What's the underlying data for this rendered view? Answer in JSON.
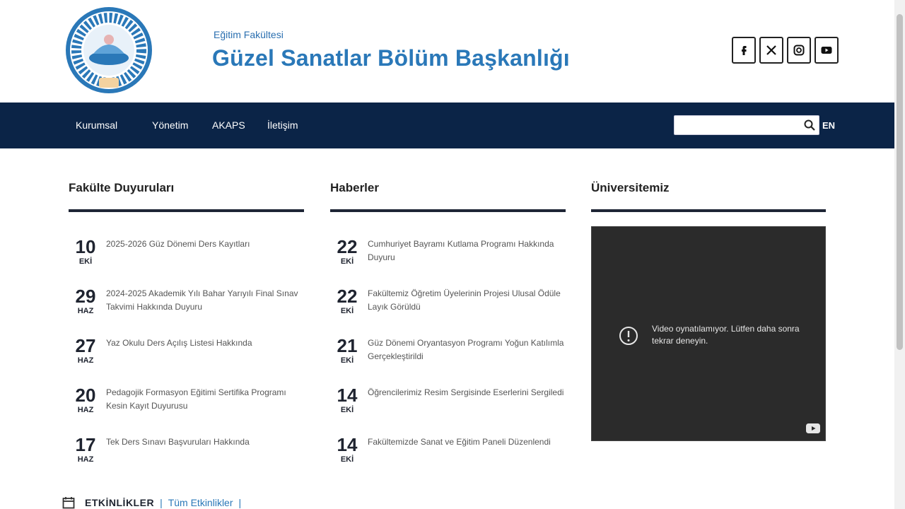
{
  "header": {
    "faculty_name": "Eğitim Fakültesi",
    "site_title": "Güzel Sanatlar Bölüm Başkanlığı",
    "social": [
      "facebook-icon",
      "x-icon",
      "instagram-icon",
      "youtube-icon"
    ]
  },
  "nav": {
    "items": [
      "Kurumsal",
      "Yönetim",
      "AKAPS",
      "İletişim"
    ],
    "search_placeholder": "",
    "lang": "EN"
  },
  "columns": {
    "events": {
      "title": "Fakülte Duyuruları",
      "items": [
        {
          "day": "10",
          "month": "EKİ",
          "text": "2025-2026 Güz Dönemi Ders Kayıtları"
        },
        {
          "day": "29",
          "month": "HAZ",
          "text": "2024-2025 Akademik Yılı Bahar Yarıyılı Final Sınav Takvimi Hakkında Duyuru"
        },
        {
          "day": "27",
          "month": "HAZ",
          "text": "Yaz Okulu Ders Açılış Listesi Hakkında"
        },
        {
          "day": "20",
          "month": "HAZ",
          "text": "Pedagojik Formasyon Eğitimi Sertifika Programı Kesin Kayıt Duyurusu"
        },
        {
          "day": "17",
          "month": "HAZ",
          "text": "Tek Ders Sınavı Başvuruları Hakkında"
        }
      ]
    },
    "news": {
      "title": "Haberler",
      "items": [
        {
          "day": "22",
          "month": "EKİ",
          "text": "Cumhuriyet Bayramı Kutlama Programı Hakkında Duyuru"
        },
        {
          "day": "22",
          "month": "EKİ",
          "text": "Fakültemiz Öğretim Üyelerinin Projesi Ulusal Ödüle Layık Görüldü"
        },
        {
          "day": "21",
          "month": "EKİ",
          "text": "Güz Dönemi Oryantasyon Programı Yoğun Katılımla Gerçekleştirildi"
        },
        {
          "day": "14",
          "month": "EKİ",
          "text": "Öğrencilerimiz Resim Sergisinde Eserlerini Sergiledi"
        },
        {
          "day": "14",
          "month": "EKİ",
          "text": "Fakültemizde Sanat ve Eğitim Paneli Düzenlendi"
        }
      ]
    },
    "university": {
      "title": "Üniversitemiz",
      "video_message": "Video oynatılamıyor. Lütfen daha sonra tekrar deneyin."
    }
  },
  "footer": {
    "all_events": "ETKİNLİKLER",
    "separator": "|",
    "more": "Tüm Etkinlikler"
  },
  "colors": {
    "nav_bg": "#0b2447",
    "title_blue": "#2a78b8",
    "rule": "#1e2535",
    "video_bg": "#2b2b2b"
  }
}
